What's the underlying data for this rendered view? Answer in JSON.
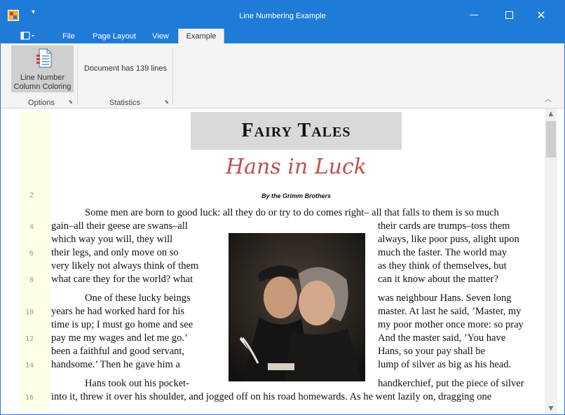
{
  "window": {
    "title": "Line Numbering Example"
  },
  "title_bar": {
    "quick_access": "▾",
    "minimize": "—",
    "close": "✕"
  },
  "tabs": [
    {
      "label": "File"
    },
    {
      "label": "Page Layout"
    },
    {
      "label": "View"
    },
    {
      "label": "Example",
      "active": true
    }
  ],
  "ribbon": {
    "options_group": {
      "button_line1": "Line Number",
      "button_line2": "Column Coloring",
      "label": "Options"
    },
    "statistics_group": {
      "text": "Document has 139 lines",
      "label": "Statistics"
    },
    "launcher": "⬊",
    "collapse": "︿"
  },
  "document": {
    "title": "Fairy Tales",
    "subtitle": "Hans in Luck",
    "byline": "By the Grimm Brothers",
    "line_numbers": [
      "2",
      "4",
      "6",
      "8",
      "10",
      "12",
      "14",
      "16"
    ],
    "lines": [
      {
        "text": "Some men are born to good luck: all they do or try to do comes right– all that falls to them is so much"
      },
      {
        "left": "gain–all their geese are swans–all",
        "right": "their cards are trumps–toss them"
      },
      {
        "left": "which way you will, they will",
        "right": "always, like poor puss, alight upon"
      },
      {
        "left": "their legs, and only move on so",
        "right": "much the faster. The world may"
      },
      {
        "left": "very likely not always think of them",
        "right": "as they think of themselves, but"
      },
      {
        "left": "what care they for the world? what",
        "right": "can it know about the matter?"
      },
      {
        "left": "One of these lucky beings",
        "right": "was neighbour Hans. Seven long"
      },
      {
        "left": "years he had worked hard for his",
        "right": "master. At last he said, ’Master, my"
      },
      {
        "left": "time is up; I must go home and see",
        "right": "my poor mother once more: so pray"
      },
      {
        "left": "pay me my wages and let me go.’",
        "right": "And the master said, ’You have"
      },
      {
        "left": "been a faithful and good servant,",
        "right": "Hans, so your pay shall be"
      },
      {
        "left": "handsome.’ Then he gave him a",
        "right": "lump of silver as big as his head."
      },
      {
        "left": "Hans took out his pocket-",
        "right": "handkerchief, put the piece of silver"
      },
      {
        "text": "into it, threw it over his shoulder, and jogged off on his road homewards. As he went lazily on, dragging one"
      }
    ]
  },
  "colors": {
    "titlebar": "#1f7bd8",
    "ribbon": "#f3f3f3",
    "line_column": "#ffffe6",
    "subtitle": "#c0504d"
  },
  "icons": [
    "app-icon",
    "file-menu-icon",
    "document-lines-icon",
    "dialog-launcher-icon",
    "collapse-ribbon-icon"
  ]
}
